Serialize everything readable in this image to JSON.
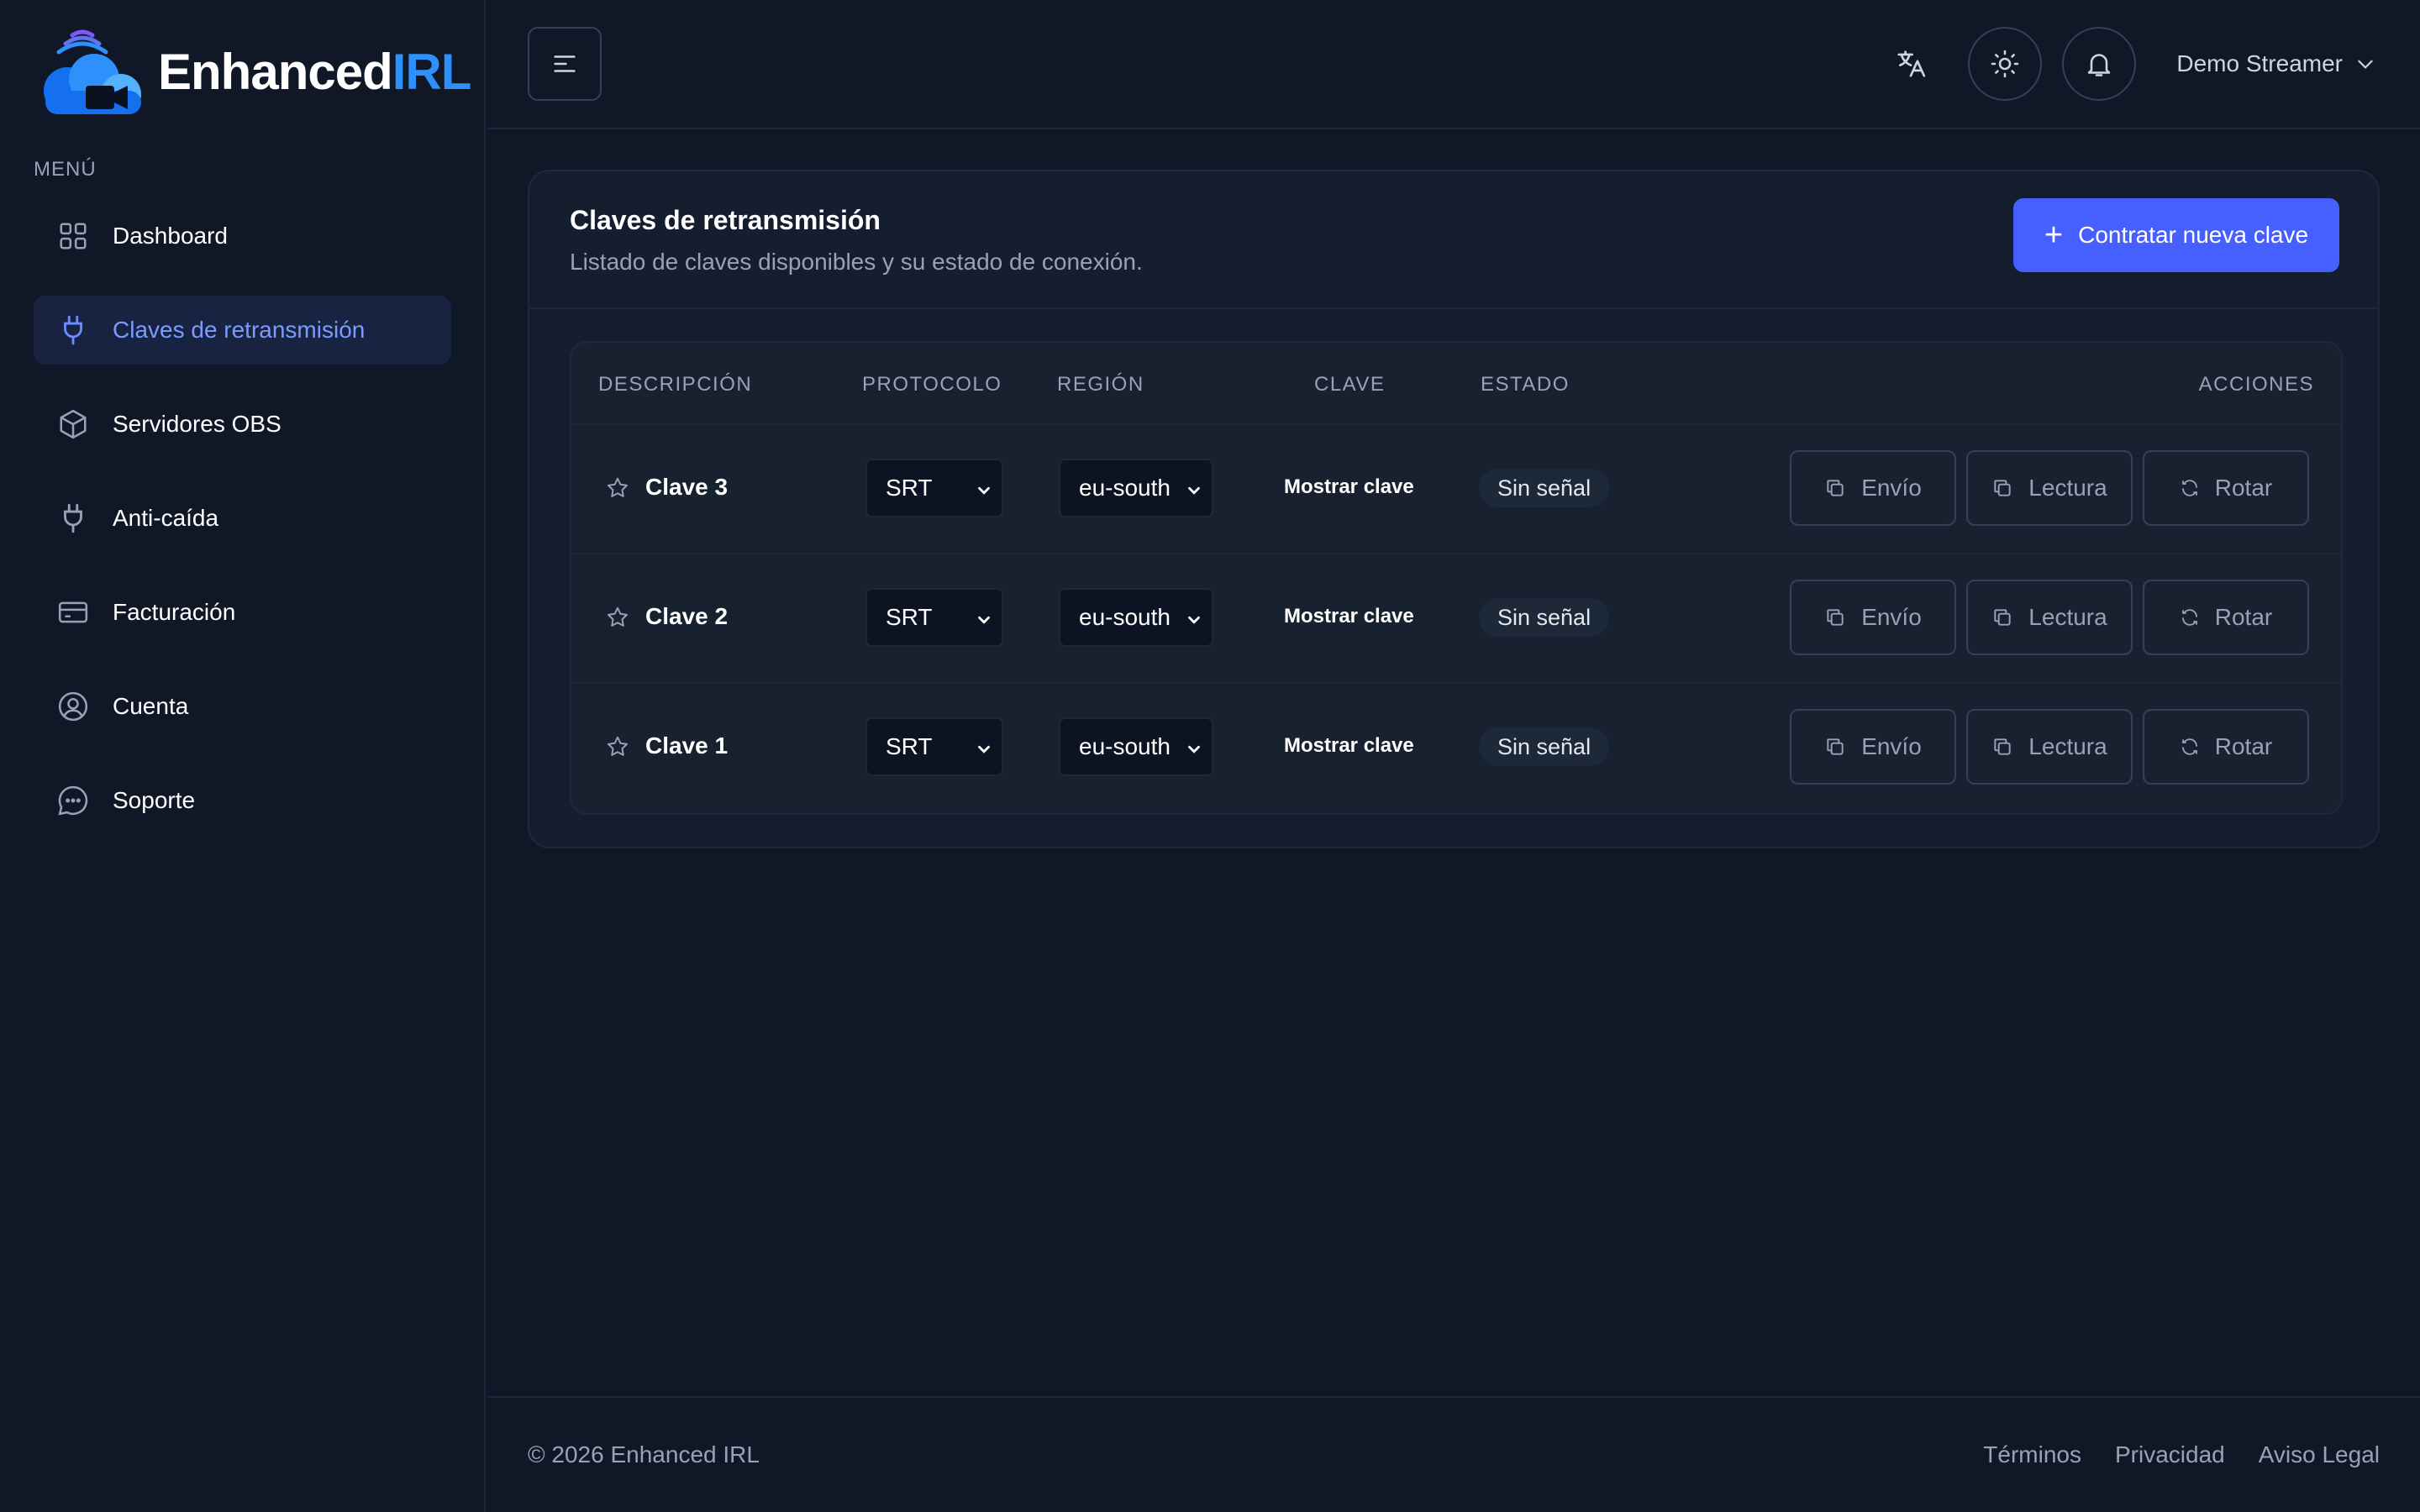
{
  "brand": {
    "name_main": "Enhanced",
    "name_accent": "IRL"
  },
  "sidebar": {
    "menu_label": "MENÚ",
    "items": [
      {
        "label": "Dashboard",
        "icon": "grid-icon",
        "active": false
      },
      {
        "label": "Claves de retransmisión",
        "icon": "plug-icon",
        "active": true
      },
      {
        "label": "Servidores OBS",
        "icon": "cube-icon",
        "active": false
      },
      {
        "label": "Anti-caída",
        "icon": "plug-icon",
        "active": false
      },
      {
        "label": "Facturación",
        "icon": "credit-card-icon",
        "active": false
      },
      {
        "label": "Cuenta",
        "icon": "user-circle-icon",
        "active": false
      },
      {
        "label": "Soporte",
        "icon": "chat-bubble-icon",
        "active": false
      }
    ]
  },
  "header": {
    "user_name": "Demo Streamer",
    "icons": [
      "menu-icon",
      "translate-icon",
      "sun-icon",
      "bell-icon",
      "chevron-down-icon"
    ]
  },
  "card": {
    "title": "Claves de retransmisión",
    "subtitle": "Listado de claves disponibles y su estado de conexión.",
    "new_key_button": "Contratar nueva clave"
  },
  "table": {
    "columns": [
      "DESCRIPCIÓN",
      "PROTOCOLO",
      "REGIÓN",
      "CLAVE",
      "ESTADO",
      "ACCIONES"
    ],
    "rows": [
      {
        "description": "Clave 3",
        "protocol": "SRT",
        "region": "eu-south",
        "key": "Mostrar clave",
        "status": "Sin señal"
      },
      {
        "description": "Clave 2",
        "protocol": "SRT",
        "region": "eu-south",
        "key": "Mostrar clave",
        "status": "Sin señal"
      },
      {
        "description": "Clave 1",
        "protocol": "SRT",
        "region": "eu-south",
        "key": "Mostrar clave",
        "status": "Sin señal"
      }
    ],
    "actions": {
      "send": "Envío",
      "read": "Lectura",
      "rotate": "Rotar"
    }
  },
  "footer": {
    "copyright": "© 2026 Enhanced IRL",
    "links": [
      "Términos",
      "Privacidad",
      "Aviso Legal"
    ]
  },
  "colors": {
    "background": "#101828",
    "accent": "#465fff",
    "brand_blue": "#2e90fa",
    "active_nav": "#7b9bff"
  }
}
